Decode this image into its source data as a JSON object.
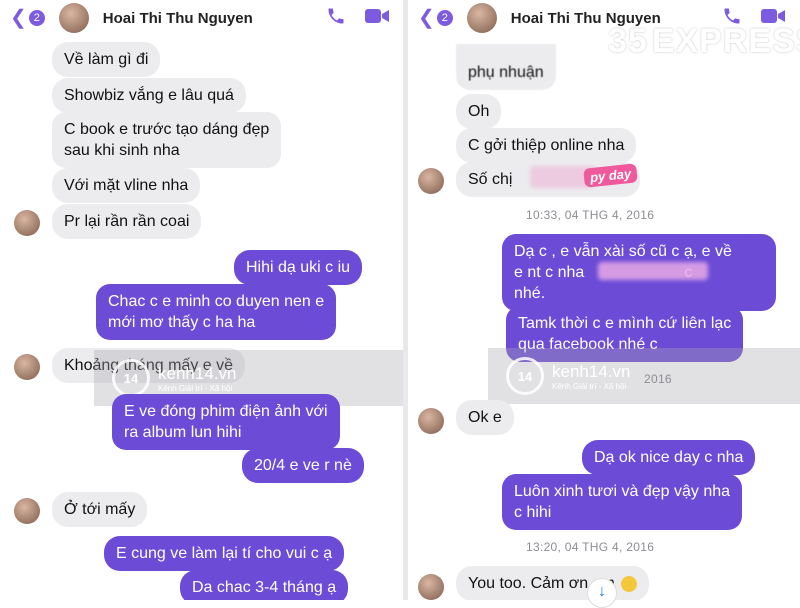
{
  "left": {
    "header": {
      "back_count": "2",
      "name": "Hoai Thi Thu Nguyen"
    },
    "messages": [
      {
        "side": "in",
        "text": "Về làm gì đi"
      },
      {
        "side": "in",
        "text": "Showbiz vắng e lâu quá"
      },
      {
        "side": "in",
        "lines": [
          "C book e trước tạo dáng đẹp",
          "sau khi sinh nha"
        ]
      },
      {
        "side": "in",
        "text": "Với mặt vline nha"
      },
      {
        "side": "in",
        "text": "Pr lại rần rần coai"
      },
      {
        "side": "out",
        "text": "Hihi dạ uki c iu"
      },
      {
        "side": "out",
        "lines": [
          "Chac c e minh co duyen nen e",
          "mới mơ thấy c ha ha"
        ]
      },
      {
        "side": "in",
        "text": "Khoảng tháng mấy e về"
      },
      {
        "side": "out",
        "lines": [
          "E ve đóng phim điện ảnh với",
          "ra album lun hihi"
        ]
      },
      {
        "side": "out",
        "text": "20/4 e ve r nè"
      },
      {
        "side": "in",
        "text": "Ở tới mấy"
      },
      {
        "side": "out",
        "text": "E cung ve làm lại tí cho vui c ạ"
      },
      {
        "side": "out",
        "text": "Da chac 3-4 tháng ạ"
      }
    ],
    "watermark": {
      "badge": "14",
      "site": "kenh14.vn",
      "tagline": "Kênh Giải trí - Xã hội"
    }
  },
  "right": {
    "header": {
      "back_count": "2",
      "name": "Hoai Thi Thu Nguyen"
    },
    "messages": [
      {
        "side": "in",
        "text": "phụ nhuận"
      },
      {
        "side": "in",
        "text": "Oh"
      },
      {
        "side": "in",
        "text": "C gởi thiệp online nha"
      },
      {
        "side": "in",
        "text": "Số chị"
      },
      {
        "side": "out",
        "lines": [
          "Dạ c , e vẫn xài số cũ c ạ, e về",
          "e nt c nha",
          "nhé."
        ],
        "tail": "c"
      },
      {
        "side": "out",
        "lines": [
          "Tamk thời c e mình cứ liên lạc",
          "qua facebook nhé c"
        ]
      },
      {
        "side": "in",
        "text": "Ok e"
      },
      {
        "side": "out",
        "text": "Dạ ok nice day c nha"
      },
      {
        "side": "out",
        "lines": [
          "Luôn xinh tươi và đẹp vậy nha",
          "c hihi"
        ]
      },
      {
        "side": "in",
        "text": "You too. Cảm ơn em"
      }
    ],
    "timestamps": [
      "10:33, 04 THG 4, 2016",
      "2016",
      "13:20, 04 THG 4, 2016"
    ],
    "sticker_text": "py day",
    "watermark": {
      "badge": "14",
      "site": "kenh14.vn",
      "tagline": "Kênh Giải trí - Xã hội"
    }
  },
  "brand": {
    "logo_num": "35",
    "logo_text": "EXPRESS"
  },
  "colors": {
    "outgoing": "#6c4bd7",
    "incoming": "#ececef",
    "accent": "#7d5be0"
  }
}
